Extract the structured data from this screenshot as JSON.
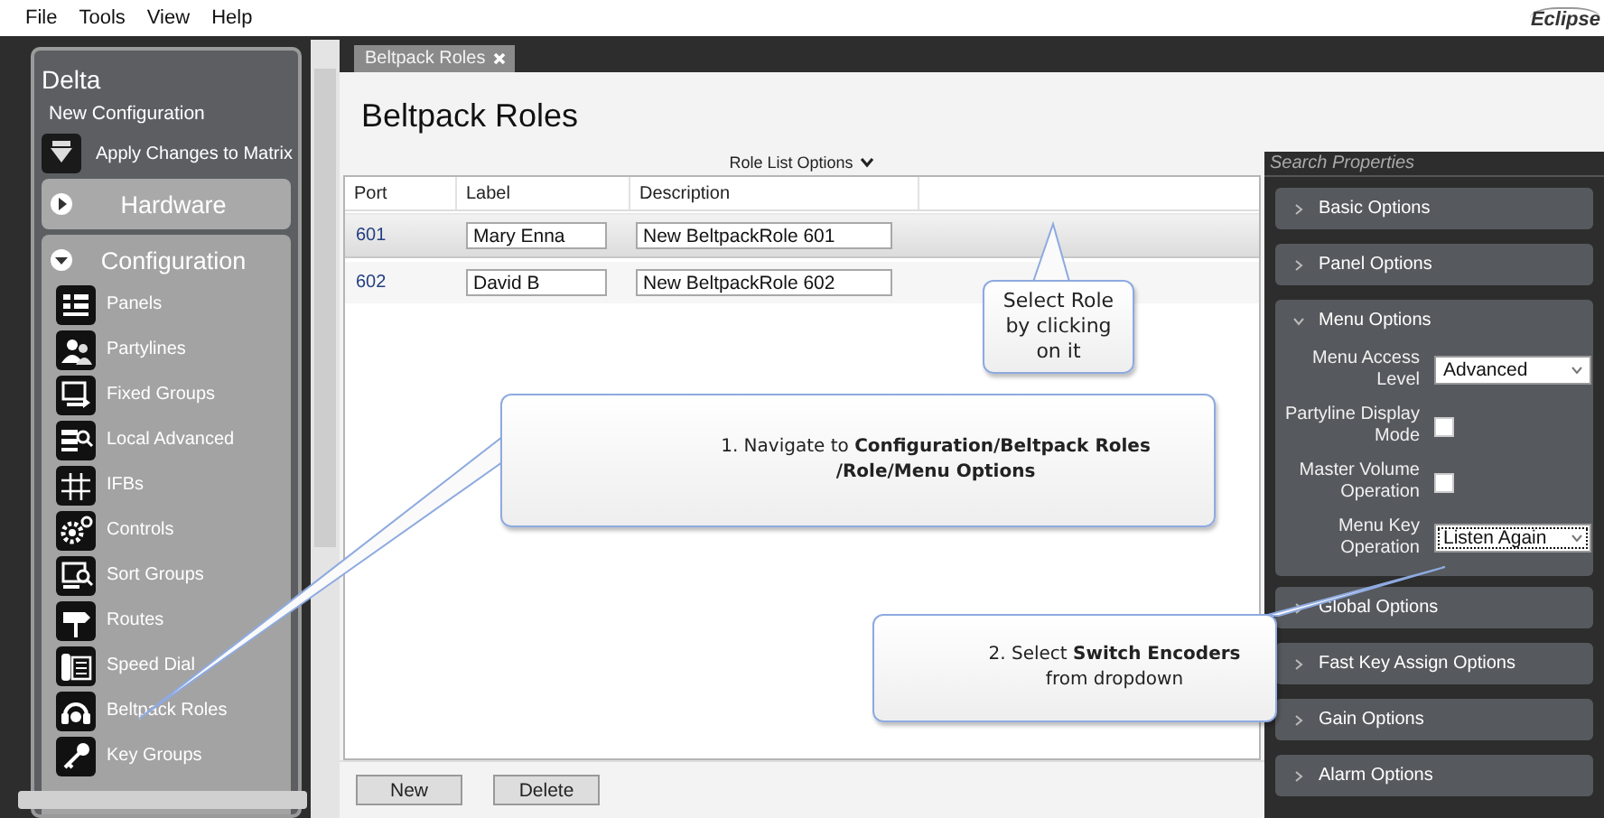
{
  "menu_bar": {
    "items": [
      "File",
      "Tools",
      "View",
      "Help"
    ],
    "logo": "Eclipse"
  },
  "sidebar": {
    "title": "Delta",
    "configuration_name": "New Configuration",
    "apply_action": "Apply Changes to Matrix",
    "sections": [
      {
        "label": "Hardware",
        "expanded": false
      },
      {
        "label": "Configuration",
        "expanded": true,
        "items": [
          {
            "label": "Panels",
            "kind": "panels"
          },
          {
            "label": "Partylines",
            "kind": "partylines"
          },
          {
            "label": "Fixed Groups",
            "kind": "fixed"
          },
          {
            "label": "Local Advanced",
            "kind": "local"
          },
          {
            "label": "IFBs",
            "kind": "ifbs"
          },
          {
            "label": "Controls",
            "kind": "controls"
          },
          {
            "label": "Sort Groups",
            "kind": "sort"
          },
          {
            "label": "Routes",
            "kind": "routes"
          },
          {
            "label": "Speed Dial",
            "kind": "dials"
          },
          {
            "label": "Beltpack Roles",
            "kind": "beltpack"
          },
          {
            "label": "Key Groups",
            "kind": "keys"
          }
        ]
      }
    ]
  },
  "tabs": [
    {
      "label": "Beltpack Roles",
      "selected": true
    }
  ],
  "page_title": "Beltpack Roles",
  "list_options": "Role List Options",
  "table": {
    "columns": [
      "Port",
      "Label",
      "Description"
    ],
    "rows": [
      {
        "port": "601",
        "label": "Mary Enna",
        "description": "New BeltpackRole 601",
        "selected": true
      },
      {
        "port": "602",
        "label": "David B",
        "description": "New BeltpackRole 602",
        "selected": false
      }
    ]
  },
  "buttons": [
    "New",
    "Delete"
  ],
  "properties": {
    "search": {
      "placeholder": "Search Properties"
    },
    "sections": [
      {
        "title": "Basic Options",
        "expanded": false
      },
      {
        "title": "Panel Options",
        "expanded": false
      },
      {
        "title": "Menu Options",
        "expanded": true,
        "fields": [
          {
            "kind": "select",
            "label": "Menu Access Level",
            "value": "Advanced",
            "focused": false
          },
          {
            "kind": "checkbox",
            "label": "Partyline Display Mode",
            "checked": false
          },
          {
            "kind": "checkbox",
            "label": "Master Volume Operation",
            "checked": false
          },
          {
            "kind": "select",
            "label": "Menu Key Operation",
            "value": "Listen Again",
            "focused": true
          }
        ]
      },
      {
        "title": "Global Options",
        "expanded": false
      },
      {
        "title": "Fast Key Assign Options",
        "expanded": false
      },
      {
        "title": "Gain Options",
        "expanded": false
      },
      {
        "title": "Alarm Options",
        "expanded": false
      }
    ]
  },
  "callouts": [
    {
      "text": "Select Role\nby clicking\non it"
    },
    {
      "text": "1. Navigate to **Configuration/Beltpack Roles**\n**/Role/Menu Options**"
    },
    {
      "text": "2. Select **Switch Encoders**\nfrom dropdown"
    }
  ]
}
